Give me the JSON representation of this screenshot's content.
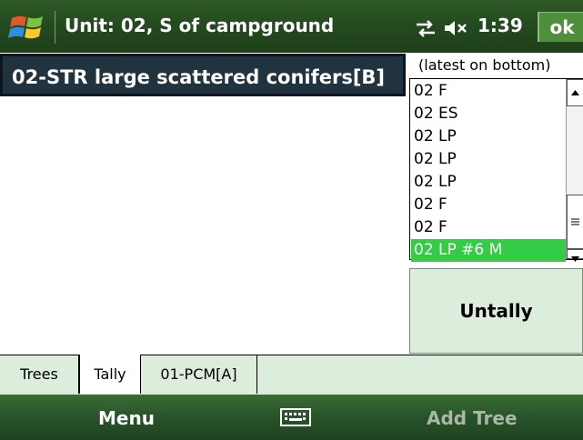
{
  "title_bar": {
    "title": "Unit: 02, S of campground",
    "clock": "1:39",
    "ok_label": "ok",
    "icons": [
      "windows-start-icon",
      "connectivity-icon",
      "volume-muted-icon"
    ]
  },
  "stratum": {
    "title": "02-STR large scattered conifers[B]"
  },
  "tree_list": {
    "caption": "(latest on bottom)",
    "items": [
      "02 F",
      "02 ES",
      "02 LP",
      "02 LP",
      "02 LP",
      "02 F",
      "02 F",
      "02 LP #6 M"
    ],
    "selected_index": 7,
    "selected_color": "#33cc44"
  },
  "actions": {
    "untally_label": "Untally"
  },
  "tabs": [
    {
      "label": "Trees",
      "active": false
    },
    {
      "label": "Tally",
      "active": true
    },
    {
      "label": "01-PCM[A]",
      "active": false
    }
  ],
  "softkeys": {
    "left": "Menu",
    "right": "Add Tree",
    "right_enabled": false
  },
  "colors": {
    "title_bar": "#244b1f",
    "accent_green": "#4d8f3a",
    "tab_background": "#dceedb",
    "stratum_background": "#20333f"
  }
}
